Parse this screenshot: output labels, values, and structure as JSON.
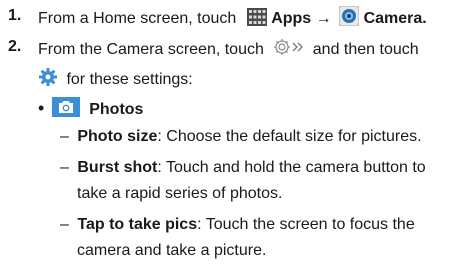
{
  "steps": [
    {
      "number": "1.",
      "pre": "From a Home screen, touch",
      "apps_label": "Apps",
      "arrow": "→",
      "camera_label": "Camera",
      "end": "."
    },
    {
      "number": "2.",
      "line1": "From the Camera screen, touch",
      "line1_end": "and then touch",
      "line2": "for these settings:"
    }
  ],
  "section": {
    "bullet": "•",
    "title": "Photos"
  },
  "options": [
    {
      "dash": "–",
      "name": "Photo size",
      "sep": ":",
      "text": "Choose the default size for pictures."
    },
    {
      "dash": "–",
      "name": "Burst shot",
      "sep": ":",
      "text": "Touch and hold the camera button to",
      "text2": "take a rapid series of photos."
    },
    {
      "dash": "–",
      "name": "Tap to take pics",
      "sep": ":",
      "text": "Touch the screen to focus the",
      "text2": "camera and take a picture."
    }
  ],
  "icons": {
    "apps": "apps-grid-icon",
    "camera": "camera-app-icon",
    "mode": "camera-mode-icon",
    "settings": "gear-icon",
    "photos": "photo-camera-icon"
  },
  "colors": {
    "accent": "#3a8fd6",
    "icon_bg": "#4a4a4a"
  }
}
